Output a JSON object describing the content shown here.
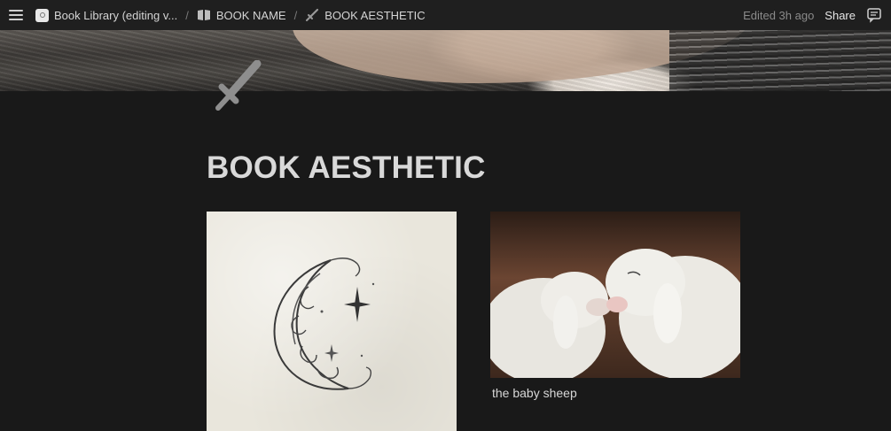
{
  "topbar": {
    "breadcrumbs": [
      {
        "label": "Book Library (editing v...",
        "icon": "app-icon"
      },
      {
        "label": "BOOK NAME",
        "icon": "open-book-icon"
      },
      {
        "label": "BOOK AESTHETIC",
        "icon": "sword-icon"
      }
    ],
    "separator": "/",
    "edited_label": "Edited 3h ago",
    "share_label": "Share"
  },
  "page": {
    "title": "BOOK AESTHETIC",
    "icon": "sword-icon"
  },
  "gallery": {
    "items": [
      {
        "image": "ornate-crescent-moon-illustration",
        "caption": ""
      },
      {
        "image": "two-baby-lambs-photo",
        "caption": "the baby sheep"
      }
    ]
  },
  "colors": {
    "background": "#191919",
    "topbar": "#1f1f1f",
    "text": "#d4d4d4",
    "muted": "#8a8a8a"
  }
}
